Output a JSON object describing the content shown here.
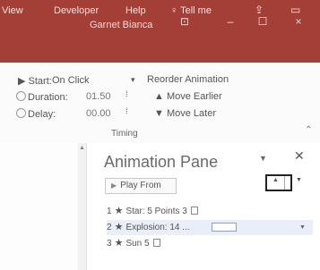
{
  "titlebar": {
    "user": "Garnet Bianca",
    "profile_icon": "profile-card-icon",
    "minimize": "‒",
    "maximize": "☐",
    "close": "×"
  },
  "tabs": {
    "view": "View",
    "developer": "Developer",
    "help": "Help",
    "tellme": "Tell me"
  },
  "timing": {
    "start_label": "Start:",
    "start_value": "On Click",
    "duration_label": "Duration:",
    "duration_value": "01.50",
    "delay_label": "Delay:",
    "delay_value": "00.00",
    "reorder_label": "Reorder Animation",
    "move_earlier": "Move Earlier",
    "move_later": "Move Later",
    "group_label": "Timing"
  },
  "pane": {
    "title": "Animation Pane",
    "play_from": "Play From",
    "items": [
      {
        "num": "1",
        "name": "Star: 5 Points 3"
      },
      {
        "num": "2",
        "name": "Explosion: 14 ..."
      },
      {
        "num": "3",
        "name": "Sun 5"
      }
    ]
  }
}
